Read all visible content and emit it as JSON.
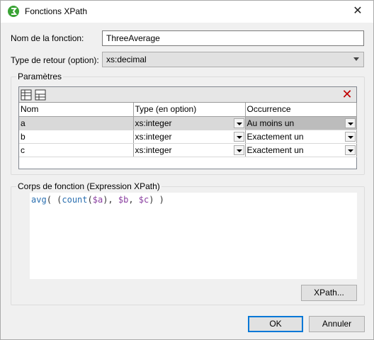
{
  "window": {
    "title": "Fonctions XPath",
    "close_glyph": "✕",
    "app_icon": "xpath-app-icon",
    "accent": "#0078d7"
  },
  "form": {
    "name_label": "Nom de la fonction:",
    "name_value": "ThreeAverage",
    "return_label": "Type de retour (option):",
    "return_value": "xs:decimal"
  },
  "params": {
    "group_title": "Paramètres",
    "toolbar": {
      "append_icon": "append-row-icon",
      "insert_icon": "insert-row-icon",
      "delete_glyph": "✕",
      "delete_color": "#c00000"
    },
    "columns": [
      "Nom",
      "Type (en option)",
      "Occurrence"
    ],
    "rows": [
      {
        "name": "a",
        "type": "xs:integer",
        "occurrence": "Au moins un"
      },
      {
        "name": "b",
        "type": "xs:integer",
        "occurrence": "Exactement un"
      },
      {
        "name": "c",
        "type": "xs:integer",
        "occurrence": "Exactement un"
      }
    ]
  },
  "body": {
    "group_title": "Corps de fonction (Expression XPath)",
    "code_parts": {
      "p1": "avg",
      "p2": "( (",
      "p3": "count",
      "p4": "(",
      "p5": "$a",
      "p6": "), ",
      "p7": "$b",
      "p8": ", ",
      "p9": "$c",
      "p10": ") )"
    },
    "xpath_button": "XPath..."
  },
  "footer": {
    "ok_label": "OK",
    "cancel_label": "Annuler"
  }
}
